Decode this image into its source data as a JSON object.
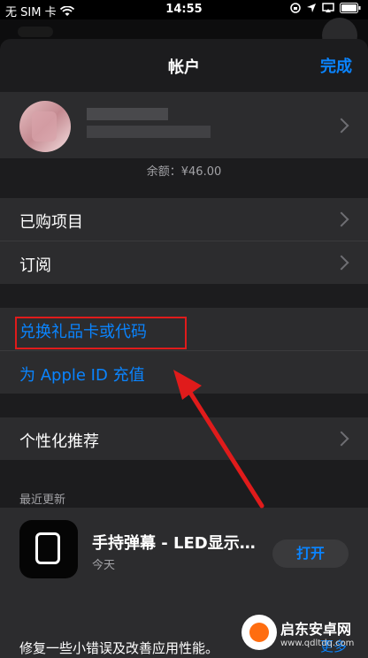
{
  "status_bar": {
    "carrier": "无 SIM 卡",
    "time": "14:55"
  },
  "nav": {
    "title": "帐户",
    "done": "完成"
  },
  "profile": {
    "balance": "余额：¥46.00"
  },
  "menu_group1": [
    {
      "label": "已购项目"
    },
    {
      "label": "订阅"
    }
  ],
  "menu_group2": [
    {
      "label": "兑换礼品卡或代码"
    },
    {
      "label": "为 Apple ID 充值"
    }
  ],
  "menu_group3": [
    {
      "label": "个性化推荐"
    }
  ],
  "recent": {
    "header": "最近更新",
    "app_title": "手持弹幕 - LED显示…",
    "app_date": "今天",
    "open_label": "打开",
    "description": "修复一些小错误及改善应用性能。",
    "more_label": "更多"
  },
  "watermark": {
    "name": "启东安卓网",
    "url": "www.qdltdq.com"
  },
  "colors": {
    "accent": "#0a84ff",
    "highlight": "#e01b1b",
    "arrow": "#e01b1b"
  }
}
